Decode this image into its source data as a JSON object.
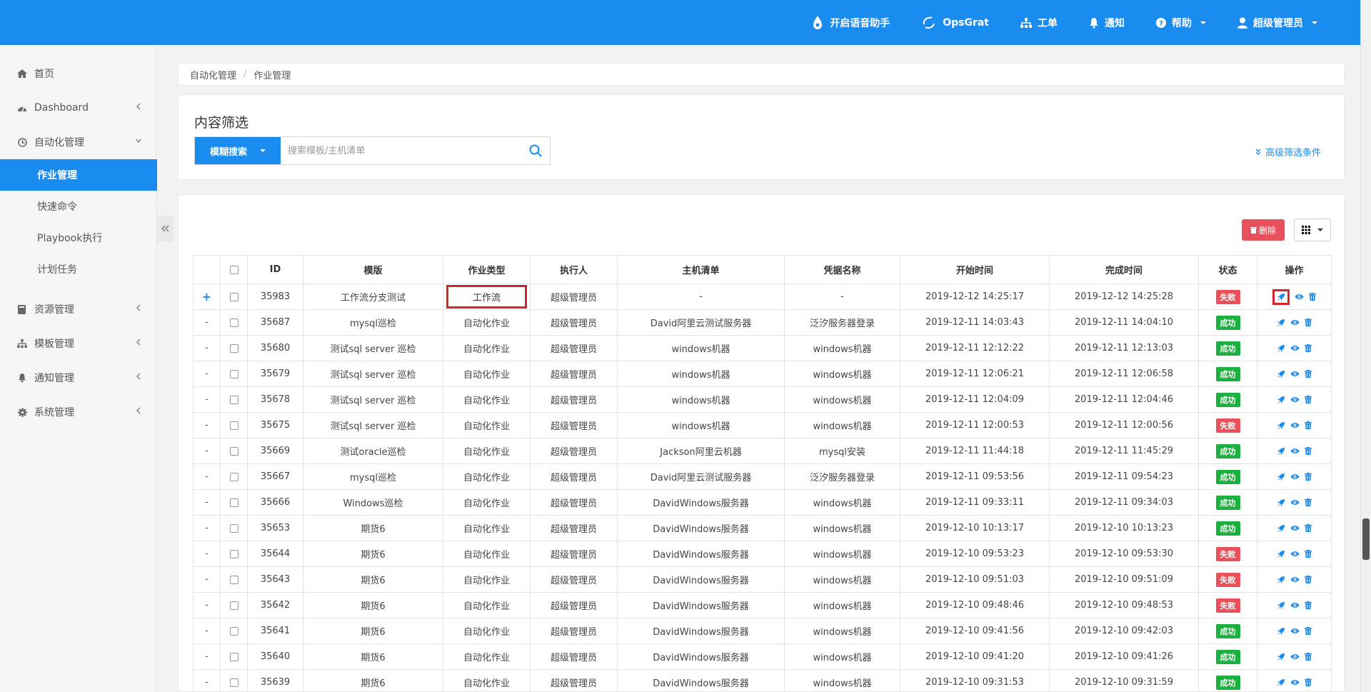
{
  "topnav": {
    "voice": "开启语音助手",
    "opsgrat": "OpsGrat",
    "ticket": "工单",
    "notify": "通知",
    "help": "帮助",
    "user": "超级管理员"
  },
  "sidebar": {
    "home": "首页",
    "dashboard": "Dashboard",
    "automation": "自动化管理",
    "job_mgmt": "作业管理",
    "quick_cmd": "快速命令",
    "playbook": "Playbook执行",
    "scheduled": "计划任务",
    "resources": "资源管理",
    "templates": "模板管理",
    "notifications": "通知管理",
    "system": "系统管理"
  },
  "breadcrumb": {
    "parent": "自动化管理",
    "current": "作业管理"
  },
  "filter": {
    "title": "内容筛选",
    "search_mode": "模糊搜索",
    "placeholder": "搜索模板/主机清单",
    "advanced": "高级筛选条件"
  },
  "toolbar": {
    "delete": "删除"
  },
  "table": {
    "headers": [
      "ID",
      "模版",
      "作业类型",
      "执行人",
      "主机清单",
      "凭据名称",
      "开始时间",
      "完成时间",
      "状态",
      "操作"
    ],
    "rows": [
      {
        "expand": "+",
        "id": "35983",
        "template": "工作流分支测试",
        "type": "工作流",
        "runner": "超级管理员",
        "hosts": "-",
        "cred": "-",
        "start": "2019-12-12 14:25:17",
        "end": "2019-12-12 14:25:28",
        "status": "失败"
      },
      {
        "expand": "-",
        "id": "35687",
        "template": "mysql巡检",
        "type": "自动化作业",
        "runner": "超级管理员",
        "hosts": "David阿里云测试服务器",
        "cred": "泛汐服务器登录",
        "start": "2019-12-11 14:03:43",
        "end": "2019-12-11 14:04:10",
        "status": "成功"
      },
      {
        "expand": "-",
        "id": "35680",
        "template": "测试sql server 巡检",
        "type": "自动化作业",
        "runner": "超级管理员",
        "hosts": "windows机器",
        "cred": "windows机器",
        "start": "2019-12-11 12:12:22",
        "end": "2019-12-11 12:13:03",
        "status": "成功"
      },
      {
        "expand": "-",
        "id": "35679",
        "template": "测试sql server 巡检",
        "type": "自动化作业",
        "runner": "超级管理员",
        "hosts": "windows机器",
        "cred": "windows机器",
        "start": "2019-12-11 12:06:21",
        "end": "2019-12-11 12:06:58",
        "status": "成功"
      },
      {
        "expand": "-",
        "id": "35678",
        "template": "测试sql server 巡检",
        "type": "自动化作业",
        "runner": "超级管理员",
        "hosts": "windows机器",
        "cred": "windows机器",
        "start": "2019-12-11 12:04:09",
        "end": "2019-12-11 12:04:46",
        "status": "成功"
      },
      {
        "expand": "-",
        "id": "35675",
        "template": "测试sql server 巡检",
        "type": "自动化作业",
        "runner": "超级管理员",
        "hosts": "windows机器",
        "cred": "windows机器",
        "start": "2019-12-11 12:00:53",
        "end": "2019-12-11 12:00:56",
        "status": "失败"
      },
      {
        "expand": "-",
        "id": "35669",
        "template": "测试oracle巡检",
        "type": "自动化作业",
        "runner": "超级管理员",
        "hosts": "Jackson阿里云机器",
        "cred": "mysql安装",
        "start": "2019-12-11 11:44:18",
        "end": "2019-12-11 11:45:29",
        "status": "成功"
      },
      {
        "expand": "-",
        "id": "35667",
        "template": "mysql巡检",
        "type": "自动化作业",
        "runner": "超级管理员",
        "hosts": "David阿里云测试服务器",
        "cred": "泛汐服务器登录",
        "start": "2019-12-11 09:53:56",
        "end": "2019-12-11 09:54:23",
        "status": "成功"
      },
      {
        "expand": "-",
        "id": "35666",
        "template": "Windows巡检",
        "type": "自动化作业",
        "runner": "超级管理员",
        "hosts": "DavidWindows服务器",
        "cred": "windows机器",
        "start": "2019-12-11 09:33:11",
        "end": "2019-12-11 09:34:03",
        "status": "成功"
      },
      {
        "expand": "-",
        "id": "35653",
        "template": "期货6",
        "type": "自动化作业",
        "runner": "超级管理员",
        "hosts": "DavidWindows服务器",
        "cred": "windows机器",
        "start": "2019-12-10 10:13:17",
        "end": "2019-12-10 10:13:23",
        "status": "成功"
      },
      {
        "expand": "-",
        "id": "35644",
        "template": "期货6",
        "type": "自动化作业",
        "runner": "超级管理员",
        "hosts": "DavidWindows服务器",
        "cred": "windows机器",
        "start": "2019-12-10 09:53:23",
        "end": "2019-12-10 09:53:30",
        "status": "失败"
      },
      {
        "expand": "-",
        "id": "35643",
        "template": "期货6",
        "type": "自动化作业",
        "runner": "超级管理员",
        "hosts": "DavidWindows服务器",
        "cred": "windows机器",
        "start": "2019-12-10 09:51:03",
        "end": "2019-12-10 09:51:09",
        "status": "失败"
      },
      {
        "expand": "-",
        "id": "35642",
        "template": "期货6",
        "type": "自动化作业",
        "runner": "超级管理员",
        "hosts": "DavidWindows服务器",
        "cred": "windows机器",
        "start": "2019-12-10 09:48:46",
        "end": "2019-12-10 09:48:53",
        "status": "失败"
      },
      {
        "expand": "-",
        "id": "35641",
        "template": "期货6",
        "type": "自动化作业",
        "runner": "超级管理员",
        "hosts": "DavidWindows服务器",
        "cred": "windows机器",
        "start": "2019-12-10 09:41:56",
        "end": "2019-12-10 09:42:03",
        "status": "成功"
      },
      {
        "expand": "-",
        "id": "35640",
        "template": "期货6",
        "type": "自动化作业",
        "runner": "超级管理员",
        "hosts": "DavidWindows服务器",
        "cred": "windows机器",
        "start": "2019-12-10 09:41:20",
        "end": "2019-12-10 09:41:26",
        "status": "成功"
      },
      {
        "expand": "-",
        "id": "35639",
        "template": "期货6",
        "type": "自动化作业",
        "runner": "超级管理员",
        "hosts": "DavidWindows服务器",
        "cred": "windows机器",
        "start": "2019-12-10 09:31:53",
        "end": "2019-12-10 09:31:59",
        "status": "成功"
      }
    ]
  },
  "colors": {
    "primary": "#1a8cf0",
    "fail": "#e8505b",
    "success": "#1cb040",
    "highlight": "#d0252a"
  }
}
